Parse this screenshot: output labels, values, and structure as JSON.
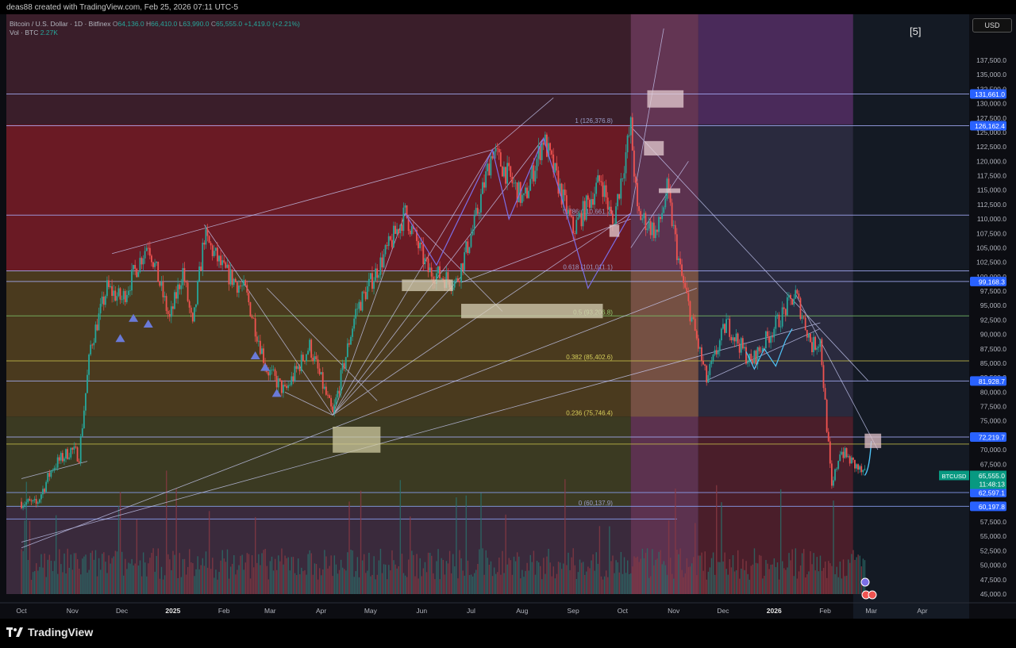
{
  "header": {
    "credit": "deas88 created with TradingView.com, Feb 25, 2026 07:11 UTC-5"
  },
  "legend": {
    "symbol": "Bitcoin / U.S. Dollar · 1D · Bitfinex",
    "o_label": "O",
    "o": "64,136.0",
    "h_label": "H",
    "h": "66,410.0",
    "l_label": "L",
    "l": "63,990.0",
    "c_label": "C",
    "c": "65,555.0",
    "change": "+1,419.0 (+2.21%)",
    "vol_label": "Vol · BTC",
    "vol": "2.27K"
  },
  "wave_label": "[5]",
  "currency": "USD",
  "footer": {
    "brand": "TradingView"
  },
  "colors": {
    "up": "#26a69a",
    "down": "#ef5350",
    "purple_line": "#7b6ee6",
    "cyan_line": "#4fc3f7",
    "fib_line": "#cfd3ff"
  },
  "chart_data": {
    "type": "candlestick",
    "title": "",
    "xlabel": "",
    "ylabel": "",
    "ylim": [
      44000,
      138500
    ],
    "y_ticks": [
      "45,000.0",
      "47,500.0",
      "50,000.0",
      "52,500.0",
      "55,000.0",
      "57,500.0",
      "60,000.0",
      "62,500.0",
      "65,000.0",
      "67,500.0",
      "70,000.0",
      "72,500.0",
      "75,000.0",
      "77,500.0",
      "80,000.0",
      "82,500.0",
      "85,000.0",
      "87,500.0",
      "90,000.0",
      "92,500.0",
      "95,000.0",
      "97,500.0",
      "100,000.0",
      "102,500.0",
      "105,000.0",
      "107,500.0",
      "110,000.0",
      "112,500.0",
      "115,000.0",
      "117,500.0",
      "120,000.0",
      "122,500.0",
      "125,000.0",
      "127,500.0",
      "130,000.0",
      "132,500.0",
      "135,000.0",
      "137,500.0"
    ],
    "x_ticks": [
      "Oct",
      "Nov",
      "Dec",
      "2025",
      "Feb",
      "Mar",
      "Apr",
      "May",
      "Jun",
      "Jul",
      "Aug",
      "Sep",
      "Oct",
      "Nov",
      "Dec",
      "2026",
      "Feb",
      "Mar",
      "Apr"
    ],
    "x_ticks_bold": [
      "2025",
      "2026"
    ],
    "price_path": [
      [
        "2024-10-01",
        61000
      ],
      [
        "2024-10-10",
        60500
      ],
      [
        "2024-10-20",
        67000
      ],
      [
        "2024-10-31",
        70000
      ],
      [
        "2024-11-05",
        69000
      ],
      [
        "2024-11-12",
        88000
      ],
      [
        "2024-11-22",
        98000
      ],
      [
        "2024-12-01",
        96000
      ],
      [
        "2024-12-17",
        106000
      ],
      [
        "2024-12-30",
        92500
      ],
      [
        "2025-01-07",
        101000
      ],
      [
        "2025-01-13",
        91000
      ],
      [
        "2025-01-20",
        107000
      ],
      [
        "2025-02-01",
        101000
      ],
      [
        "2025-02-14",
        97500
      ],
      [
        "2025-02-27",
        84000
      ],
      [
        "2025-03-10",
        80000
      ],
      [
        "2025-03-25",
        88000
      ],
      [
        "2025-04-08",
        76000
      ],
      [
        "2025-04-22",
        94000
      ],
      [
        "2025-05-10",
        104000
      ],
      [
        "2025-05-22",
        111000
      ],
      [
        "2025-06-05",
        101000
      ],
      [
        "2025-06-22",
        99000
      ],
      [
        "2025-07-03",
        109000
      ],
      [
        "2025-07-14",
        122000
      ],
      [
        "2025-08-02",
        113000
      ],
      [
        "2025-08-14",
        124000
      ],
      [
        "2025-09-01",
        108000
      ],
      [
        "2025-09-18",
        117000
      ],
      [
        "2025-09-25",
        109000
      ],
      [
        "2025-10-06",
        126000
      ],
      [
        "2025-10-10",
        111000
      ],
      [
        "2025-10-22",
        107500
      ],
      [
        "2025-10-28",
        115000
      ],
      [
        "2025-11-05",
        101000
      ],
      [
        "2025-11-21",
        82000
      ],
      [
        "2025-12-03",
        92000
      ],
      [
        "2025-12-18",
        85000
      ],
      [
        "2026-01-05",
        93000
      ],
      [
        "2026-01-14",
        97000
      ],
      [
        "2026-01-24",
        88000
      ],
      [
        "2026-01-29",
        89000
      ],
      [
        "2026-02-05",
        63000
      ],
      [
        "2026-02-10",
        70000
      ],
      [
        "2026-02-20",
        67000
      ],
      [
        "2026-02-25",
        65555
      ]
    ],
    "fib_levels": [
      {
        "ratio": "1",
        "price": 126376.8,
        "label": "1 (126,376.8)"
      },
      {
        "ratio": "0.786",
        "price": 110661.2,
        "label": "0.786 (110,661.2)"
      },
      {
        "ratio": "0.618",
        "price": 101011.1,
        "label": "0.618 (101,011.1)"
      },
      {
        "ratio": "0.5",
        "price": 93206.8,
        "label": "0.5 (93,206.8)"
      },
      {
        "ratio": "0.382",
        "price": 85402.6,
        "label": "0.382 (85,402.6)"
      },
      {
        "ratio": "0.236",
        "price": 75746.4,
        "label": "0.236 (75,746.4)"
      },
      {
        "ratio": "0",
        "price": 60137.9,
        "label": "0 (60,137.9)"
      }
    ],
    "price_labels": [
      {
        "value": "131,661.0",
        "price": 131661.0
      },
      {
        "value": "126,162.4",
        "price": 126162.4
      },
      {
        "value": "99,168.3",
        "price": 99168.3
      },
      {
        "value": "81,928.7",
        "price": 81928.7
      },
      {
        "value": "72,219.7",
        "price": 72219.7
      },
      {
        "value": "62,597.1",
        "price": 62597.1
      },
      {
        "value": "60,197.8",
        "price": 60197.8
      }
    ],
    "current": {
      "symbol": "BTCUSD",
      "price": 65555.0,
      "price_text": "65,555.0",
      "countdown": "11:48:13"
    },
    "horizontal_levels": [
      131661,
      126162.4,
      110661.2,
      101011.1,
      99168.3,
      93206.8,
      85402.6,
      81928.7,
      72219.7,
      71000,
      62597.1,
      60197.8,
      58000
    ],
    "projection": [
      [
        "2026-02-25",
        65555
      ],
      [
        "2026-03-01",
        71500
      ]
    ]
  }
}
